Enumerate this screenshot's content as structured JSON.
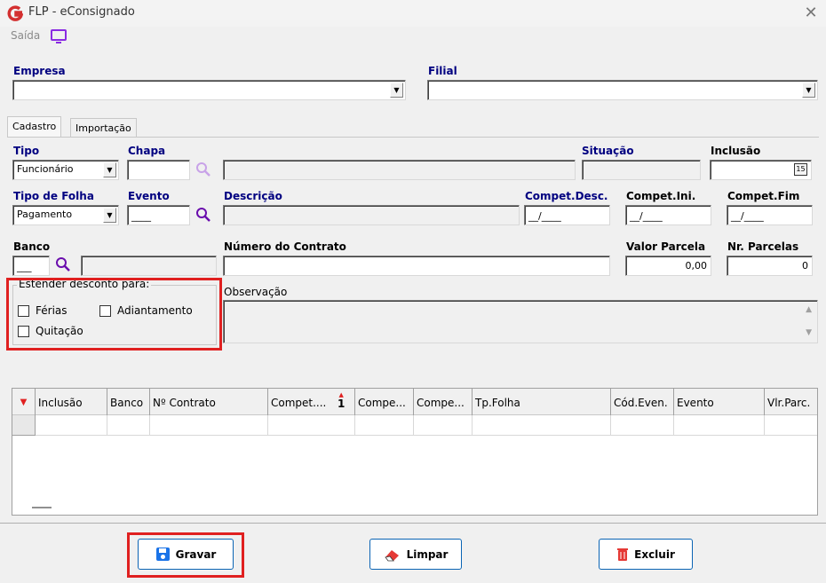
{
  "window": {
    "title": "FLP - eConsignado",
    "close": "✕"
  },
  "menu": {
    "saida": "Saída"
  },
  "labels": {
    "empresa": "Empresa",
    "filial": "Filial",
    "tipo": "Tipo",
    "chapa": "Chapa",
    "situacao": "Situação",
    "inclusao": "Inclusão",
    "tipo_folha": "Tipo de Folha",
    "evento": "Evento",
    "descricao": "Descrição",
    "compet_desc": "Compet.Desc.",
    "compet_ini": "Compet.Ini.",
    "compet_fim": "Compet.Fim",
    "banco": "Banco",
    "numero_contrato": "Número do Contrato",
    "valor_parcela": "Valor Parcela",
    "nr_parcelas": "Nr. Parcelas",
    "observacao": "Observação"
  },
  "tabs": [
    {
      "label": "Cadastro"
    },
    {
      "label": "Importação"
    }
  ],
  "fields": {
    "tipo": "Funcionário",
    "tipo_folha": "Pagamento",
    "evento_mask": "____",
    "compet_desc_mask": "__/____",
    "compet_ini_mask": "__/____",
    "compet_fim_mask": "__/____",
    "banco_mask": "___",
    "valor_parcela": "0,00",
    "nr_parcelas": "0",
    "calendar_day": "15"
  },
  "group": {
    "title": "Estender desconto para:",
    "ferias": "Férias",
    "adiantamento": "Adiantamento",
    "quitacao": "Quitação"
  },
  "grid": {
    "columns": [
      "Inclusão",
      "Banco",
      "Nº Contrato",
      "Compet....",
      "Compe...",
      "Compe...",
      "Tp.Folha",
      "Cód.Even.",
      "Evento",
      "Vlr.Parc."
    ],
    "sort_indicator": "1"
  },
  "buttons": {
    "gravar": "Gravar",
    "limpar": "Limpar",
    "excluir": "Excluir"
  },
  "colors": {
    "label_blue": "#000080",
    "highlight_red": "#e02020",
    "button_border": "#0a64b4",
    "icon_purple": "#8a2be2"
  }
}
